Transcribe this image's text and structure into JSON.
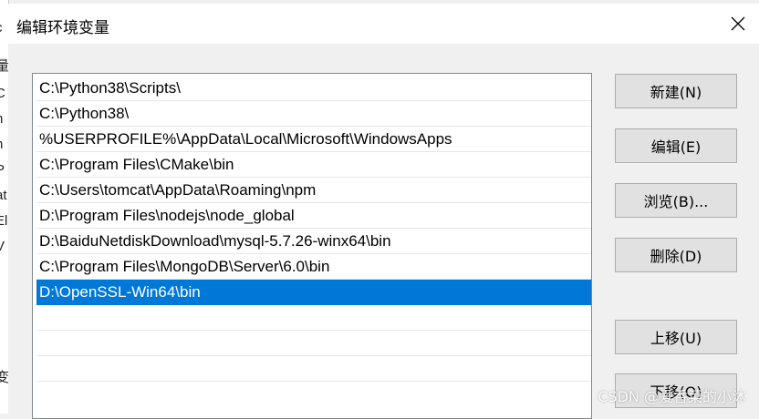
{
  "background_window": {
    "cut_off_chars": [
      "c",
      "量",
      "C",
      "n",
      "n",
      "P",
      "at",
      "El",
      "V",
      "变"
    ]
  },
  "dialog": {
    "title": "编辑环境变量",
    "close_icon": "close-icon",
    "selection_color": "#0078d7"
  },
  "path_list": {
    "items": [
      "C:\\Python38\\Scripts\\",
      "C:\\Python38\\",
      "%USERPROFILE%\\AppData\\Local\\Microsoft\\WindowsApps",
      "C:\\Program Files\\CMake\\bin",
      "C:\\Users\\tomcat\\AppData\\Roaming\\npm",
      "D:\\Program Files\\nodejs\\node_global",
      "D:\\BaiduNetdiskDownload\\mysql-5.7.26-winx64\\bin",
      "C:\\Program Files\\MongoDB\\Server\\6.0\\bin",
      "D:\\OpenSSL-Win64\\bin",
      "",
      "",
      ""
    ],
    "selected_index": 8
  },
  "buttons": {
    "new": "新建(N)",
    "edit": "编辑(E)",
    "browse": "浏览(B)...",
    "delete": "删除(D)",
    "move_up": "上移(U)",
    "move_down": "下移(O)"
  },
  "watermark": "CSDN @爱香菜的小沐"
}
